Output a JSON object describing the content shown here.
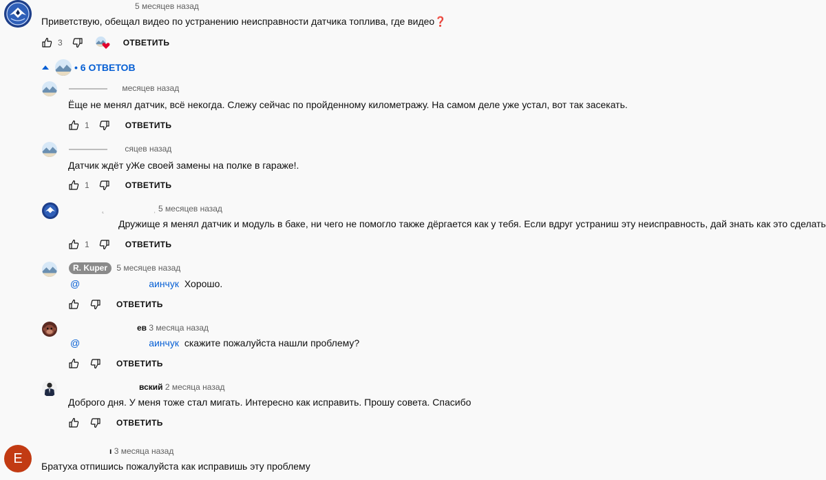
{
  "top_comment": {
    "timestamp": "5 месяцев назад",
    "text": "Приветствую, обещал видео по устранению неисправности датчика топлива, где видео",
    "emoji": "❓",
    "likes": "3",
    "reply_label": "ОТВЕТИТЬ",
    "creator_heart": true
  },
  "replies_toggle": {
    "label": "• 6 ОТВЕТОВ"
  },
  "replies": [
    {
      "time": "месяцев назад",
      "text": "Ёще не менял датчик, всё некогда. Слежу сейчас по пройденному километражу. На самом деле уже устал, вот так засекать.",
      "likes": "1",
      "reply_label": "ОТВЕТИТЬ"
    },
    {
      "time": "сяцев назад",
      "text": "Датчик ждёт уЖе своей замены на полке в гараже!.",
      "likes": "1",
      "reply_label": "ОТВЕТИТЬ"
    },
    {
      "time": "5 месяцев назад",
      "text": "Дружище я менял датчик и модуль в баке, ни чего не помогло также дёргается как у тебя. Если вдруг  устраниш эту неисправность, дай знать как это сделать",
      "likes": "1",
      "reply_label": "ОТВЕТИТЬ"
    },
    {
      "author": "R. Kuper",
      "time": "5 месяцев назад",
      "mention_start": "@",
      "mention_end": "аинчук",
      "text": "Хорошо.",
      "reply_label": "ОТВЕТИТЬ"
    },
    {
      "author_tail": "ев",
      "time": "3 месяца назад",
      "mention_start": "@",
      "mention_end": "аинчук",
      "text": "скажите пожалуйста нашли проблему?",
      "reply_label": "ОТВЕТИТЬ"
    },
    {
      "author_tail": "вский",
      "time": "2 месяца назад",
      "text": "Доброго дня. У меня тоже стал мигать. Интересно как исправить.  Прошу совета. Спасибо",
      "reply_label": "ОТВЕТИТЬ"
    }
  ],
  "bottom_comment": {
    "avatar_letter": "E",
    "avatar_color": "#c23b13",
    "time_prefix": "ı",
    "time": "3 месяца назад",
    "text": "Братуха отпишись пожалуйста как исправишь  эту проблему"
  },
  "colors": {
    "link": "#065fd4",
    "muted": "#606060",
    "heart": "#e1002d",
    "badge": "#8a8a8a"
  },
  "icons": [
    "emblem-icon",
    "thumb-up-icon",
    "thumb-down-icon",
    "triangle-up-icon",
    "heart-icon",
    "landscape-avatar",
    "person-avatar",
    "monkey-avatar"
  ]
}
